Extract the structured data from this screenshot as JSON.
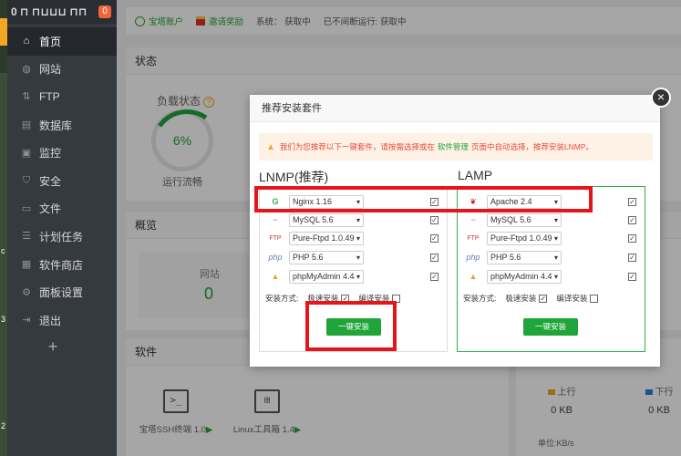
{
  "sidebar": {
    "logo_text": "0 ⊓ ⊓⊔⊔⊔ ⊓⊓",
    "badge": "0",
    "items": [
      {
        "label": "首页",
        "icon": "home-icon",
        "glyph": "⌂"
      },
      {
        "label": "网站",
        "icon": "globe-icon",
        "glyph": "◍"
      },
      {
        "label": "FTP",
        "icon": "ftp-icon",
        "glyph": "⇅"
      },
      {
        "label": "数据库",
        "icon": "database-icon",
        "glyph": "▤"
      },
      {
        "label": "监控",
        "icon": "monitor-icon",
        "glyph": "▣"
      },
      {
        "label": "安全",
        "icon": "shield-icon",
        "glyph": "⛉"
      },
      {
        "label": "文件",
        "icon": "folder-icon",
        "glyph": "▭"
      },
      {
        "label": "计划任务",
        "icon": "task-icon",
        "glyph": "☰"
      },
      {
        "label": "软件商店",
        "icon": "store-icon",
        "glyph": "▦"
      },
      {
        "label": "面板设置",
        "icon": "settings-icon",
        "glyph": "⚙"
      },
      {
        "label": "退出",
        "icon": "logout-icon",
        "glyph": "⇥"
      }
    ],
    "add": "+"
  },
  "edge_glyphs": [
    "c",
    "3",
    "2"
  ],
  "topbar": {
    "account": "宝塔账户",
    "invite": "邀请奖励",
    "system": "系统： 获取中",
    "runtime": "已不间断运行: 获取中"
  },
  "status": {
    "title": "状态",
    "load_label": "负载状态",
    "help": "?",
    "load_value": "6%",
    "load_fraction": 0.06,
    "load_desc": "运行流畅"
  },
  "overview": {
    "title": "概览",
    "site_label": "网站",
    "site_value": "0"
  },
  "software": {
    "title": "软件",
    "items": [
      {
        "name": "宝塔SSH终端 1.0",
        "icon_text": ">_"
      },
      {
        "name": "Linux工具箱 1.4",
        "icon_text": "⊞"
      }
    ],
    "arrow": "▶"
  },
  "traffic": {
    "up_label": "上行",
    "up_value": "0 KB",
    "down_label": "下行",
    "down_value": "0 KB",
    "unit": "单位:KB/s",
    "up_color": "#f5a623",
    "down_color": "#2a7fe0"
  },
  "modal": {
    "title": "推荐安装套件",
    "close": "×",
    "tip_icon": "▲",
    "tip_before": "我们为您推荐以下一键套件，请按需选择或在",
    "tip_link": "软件管理",
    "tip_after": "页面中自动选择，推荐安装LNMP。",
    "lnmp": {
      "title": "LNMP(推荐)",
      "rows": [
        {
          "logo": "G",
          "value": "Nginx 1.16",
          "checked": "✓"
        },
        {
          "logo": "~",
          "value": "MySQL 5.6",
          "checked": "✓"
        },
        {
          "logo": "FTP",
          "value": "Pure-Ftpd 1.0.49",
          "checked": "✓"
        },
        {
          "logo": "php",
          "value": "PHP 5.6",
          "checked": "✓"
        },
        {
          "logo": "▲",
          "value": "phpMyAdmin 4.4",
          "checked": "✓"
        }
      ],
      "method_label": "安装方式:",
      "fast_label": "极速安装",
      "fast_checked": "✓",
      "compile_label": "编译安装",
      "compile_checked": "",
      "button": "一键安装"
    },
    "lamp": {
      "title": "LAMP",
      "rows": [
        {
          "logo": "❦",
          "value": "Apache 2.4",
          "checked": "✓"
        },
        {
          "logo": "~",
          "value": "MySQL 5.6",
          "checked": "✓"
        },
        {
          "logo": "FTP",
          "value": "Pure-Ftpd 1.0.49",
          "checked": "✓"
        },
        {
          "logo": "php",
          "value": "PHP 5.6",
          "checked": "✓"
        },
        {
          "logo": "▲",
          "value": "phpMyAdmin 4.4",
          "checked": "✓"
        }
      ],
      "method_label": "安装方式:",
      "fast_label": "极速安装",
      "fast_checked": "✓",
      "compile_label": "编译安装",
      "compile_checked": "",
      "button": "一键安装"
    }
  },
  "colors": {
    "accent": "#20a53a",
    "sidebar_bg": "#353a3f",
    "annotation": "#e8141c"
  }
}
